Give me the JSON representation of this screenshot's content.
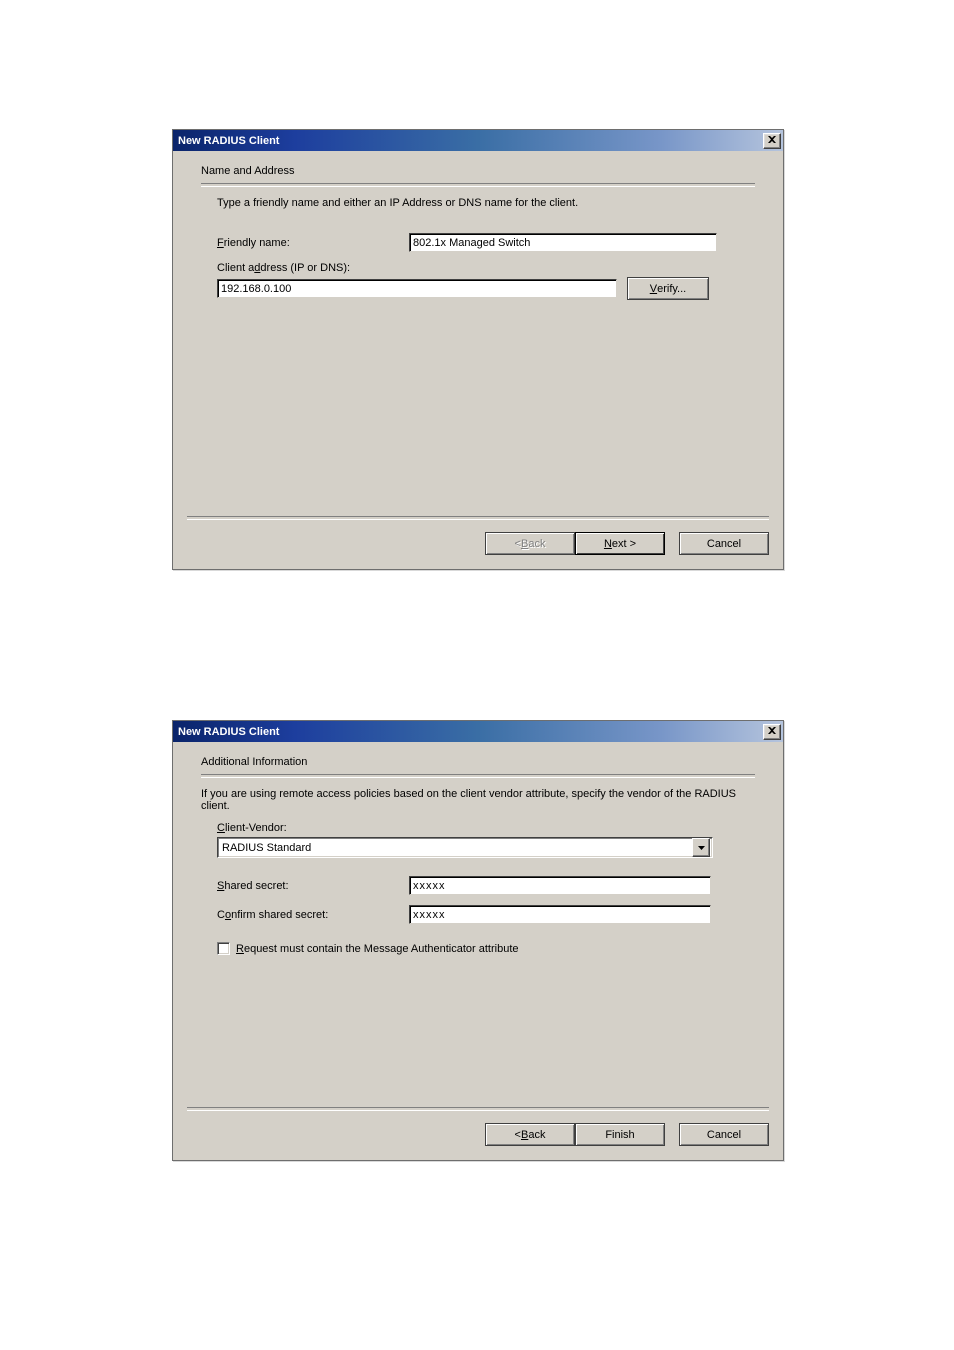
{
  "dialog1": {
    "title": "New RADIUS Client",
    "heading": "Name and Address",
    "instruction": "Type a friendly name and either an IP Address or DNS name for the client.",
    "friendly_label_pre": "F",
    "friendly_label_post": "riendly name:",
    "friendly_value": "802.1x Managed Switch",
    "address_label_pre": "Client a",
    "address_label_u": "d",
    "address_label_post": "dress (IP or DNS):",
    "address_value": "192.168.0.100",
    "verify_label_u": "V",
    "verify_label_post": "erify...",
    "back_lt": "< ",
    "back_u": "B",
    "back_post": "ack",
    "next_u": "N",
    "next_post": "ext >",
    "cancel": "Cancel"
  },
  "dialog2": {
    "title": "New RADIUS Client",
    "heading": "Additional Information",
    "instruction": "If you are using remote access policies based on the client vendor attribute, specify the vendor of the RADIUS client.",
    "vendor_label_u": "C",
    "vendor_label_post": "lient-Vendor:",
    "vendor_value": "RADIUS Standard",
    "shared_label_u": "S",
    "shared_label_post": "hared secret:",
    "shared_value": "xxxxx",
    "confirm_label_pre": "C",
    "confirm_label_u": "o",
    "confirm_label_post": "nfirm shared secret:",
    "confirm_value": "xxxxx",
    "checkbox_label_u": "R",
    "checkbox_label_post": "equest must contain the Message Authenticator attribute",
    "back_lt": "< ",
    "back_u": "B",
    "back_post": "ack",
    "finish": "Finish",
    "cancel": "Cancel"
  }
}
